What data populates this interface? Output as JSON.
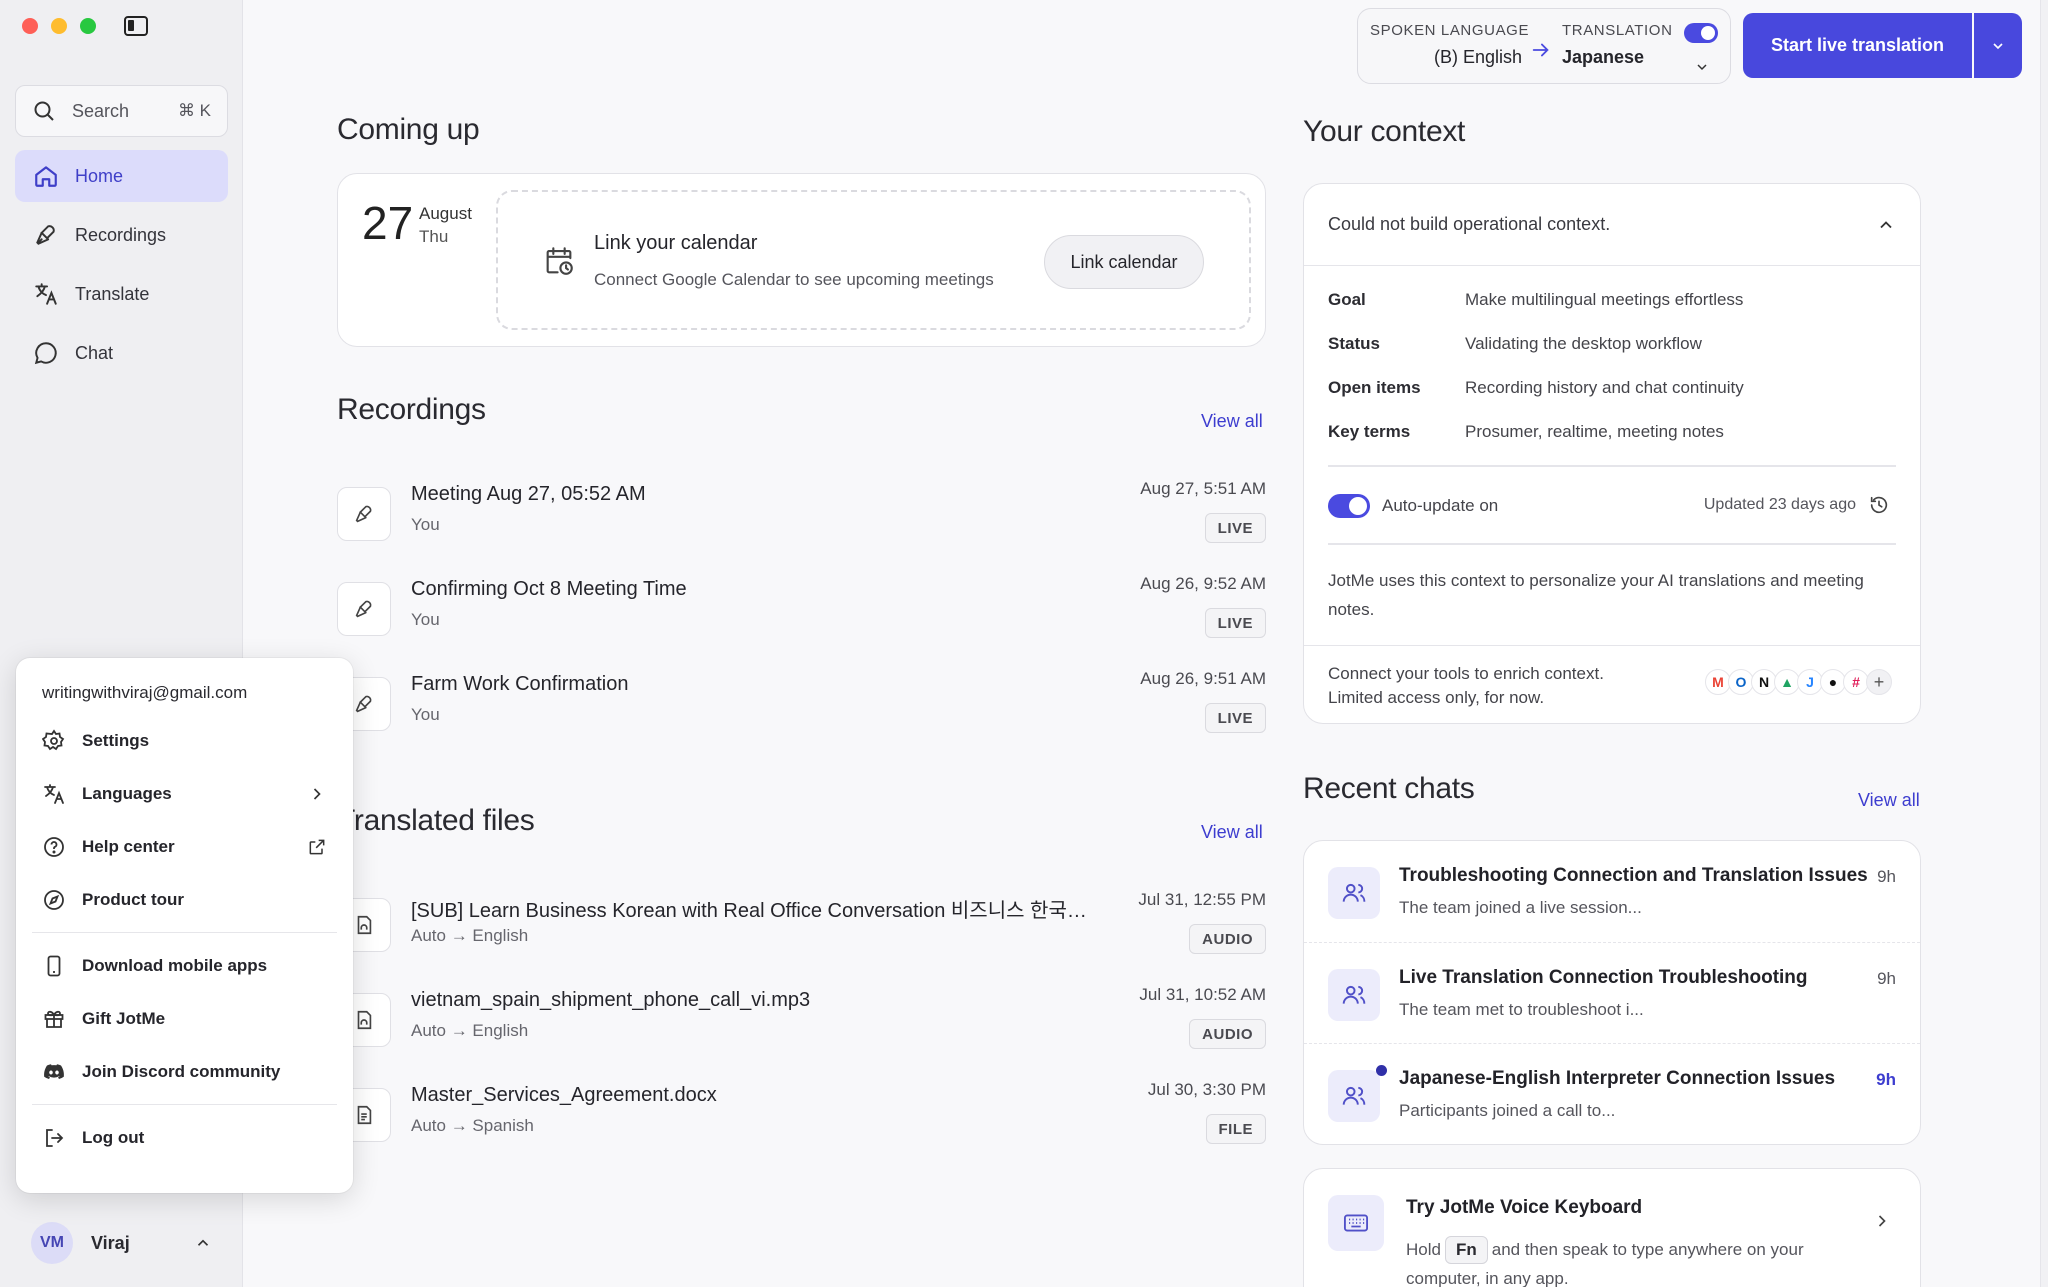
{
  "sidebar": {
    "search_label": "Search",
    "search_shortcut": "⌘ K",
    "items": [
      {
        "label": "Home",
        "icon": "home-icon"
      },
      {
        "label": "Recordings",
        "icon": "mic-icon"
      },
      {
        "label": "Translate",
        "icon": "translate-icon"
      },
      {
        "label": "Chat",
        "icon": "chat-icon"
      }
    ],
    "user": {
      "initials": "VM",
      "name": "Viraj"
    }
  },
  "user_menu": {
    "email": "writingwithviraj@gmail.com",
    "items": [
      {
        "label": "Settings",
        "icon": "gear-icon"
      },
      {
        "label": "Languages",
        "icon": "translate-icon"
      },
      {
        "label": "Help center",
        "icon": "help-icon"
      },
      {
        "label": "Product tour",
        "icon": "compass-icon"
      },
      {
        "label": "Download mobile apps",
        "icon": "phone-icon"
      },
      {
        "label": "Gift JotMe",
        "icon": "gift-icon"
      },
      {
        "label": "Join Discord community",
        "icon": "discord-icon"
      },
      {
        "label": "Log out",
        "icon": "logout-icon"
      }
    ]
  },
  "topbar": {
    "spoken_label": "SPOKEN LANGUAGE",
    "spoken_value": "(B) English",
    "translation_label": "TRANSLATION",
    "translation_value": "Japanese",
    "start_label": "Start live translation"
  },
  "coming_up": {
    "title": "Coming up",
    "day_num": "27",
    "month": "August",
    "weekday": "Thu",
    "cal_title": "Link your calendar",
    "cal_sub": "Connect Google Calendar to see upcoming meetings",
    "cal_button": "Link calendar"
  },
  "recordings": {
    "title": "Recordings",
    "view_all": "View all",
    "rows": [
      {
        "name": "Meeting Aug 27, 05:52 AM",
        "sub": "You",
        "date": "Aug 27, 5:51 AM",
        "badge": "LIVE"
      },
      {
        "name": "Confirming Oct 8 Meeting Time",
        "sub": "You",
        "date": "Aug 26, 9:52 AM",
        "badge": "LIVE"
      },
      {
        "name": "Farm Work Confirmation",
        "sub": "You",
        "date": "Aug 26, 9:51 AM",
        "badge": "LIVE"
      }
    ]
  },
  "translated_files": {
    "title": "Translated files",
    "view_all": "View all",
    "rows": [
      {
        "name": "[SUB] Learn Business Korean with Real Office Conversation 비즈니스 한국…",
        "sub": "Auto → English",
        "date": "Jul 31, 12:55 PM",
        "badge": "AUDIO"
      },
      {
        "name": "vietnam_spain_shipment_phone_call_vi.mp3",
        "sub": "Auto → English",
        "date": "Jul 31, 10:52 AM",
        "badge": "AUDIO"
      },
      {
        "name": "Master_Services_Agreement.docx",
        "sub": "Auto → Spanish",
        "date": "Jul 30, 3:30 PM",
        "badge": "FILE"
      }
    ]
  },
  "context": {
    "title": "Your context",
    "header": "Could not build operational context.",
    "fields": [
      {
        "key": "Goal",
        "value": "Make multilingual meetings effortless"
      },
      {
        "key": "Status",
        "value": "Validating the desktop workflow"
      },
      {
        "key": "Open items",
        "value": "Recording history and chat continuity"
      },
      {
        "key": "Key terms",
        "value": "Prosumer, realtime, meeting notes"
      }
    ],
    "auto_update": "Auto-update on",
    "updated": "Updated 23 days ago",
    "note": "JotMe uses this context to personalize your AI translations and meeting notes.",
    "connect_line1": "Connect your tools to enrich context.",
    "connect_line2": "Limited access only, for now.",
    "tools": [
      "gmail-icon",
      "outlook-icon",
      "notion-icon",
      "drive-icon",
      "jira-icon",
      "github-icon",
      "slack-icon"
    ]
  },
  "recent_chats": {
    "title": "Recent chats",
    "view_all": "View all",
    "rows": [
      {
        "name": "Troubleshooting Connection and Translation Issues",
        "sub": "The team joined a live session...",
        "time": "9h",
        "unread": false
      },
      {
        "name": "Live Translation Connection Troubleshooting",
        "sub": "The team met to troubleshoot i...",
        "time": "9h",
        "unread": false
      },
      {
        "name": "Japanese-English Interpreter Connection Issues",
        "sub": "Participants joined a call to...",
        "time": "9h",
        "unread": true
      }
    ]
  },
  "keyboard_card": {
    "title": "Try JotMe Voice Keyboard",
    "desc_before": "Hold",
    "key": "Fn",
    "desc_after": "and then speak to type anywhere on your computer, in any app."
  },
  "colors": {
    "accent": "#4848dd",
    "active_nav_bg": "#dcdcfb"
  }
}
